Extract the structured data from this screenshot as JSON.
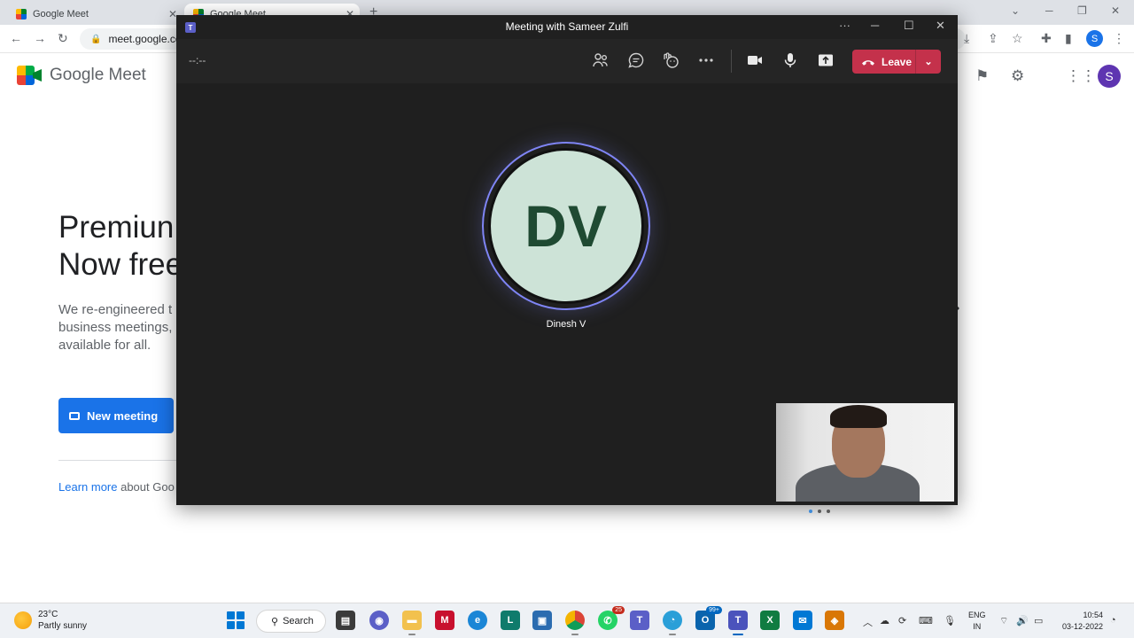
{
  "browser": {
    "tabs": [
      {
        "title": "Google Meet",
        "active": false
      },
      {
        "title": "Google Meet",
        "active": true
      }
    ],
    "new_tab_glyph": "+",
    "url": "meet.google.co",
    "profile_initial": "S"
  },
  "meet_page": {
    "logo_text": "Google Meet",
    "headline_line1": "Premiun",
    "headline_line2": "Now free",
    "sub_line1": "We re-engineered t",
    "sub_line2": "business meetings,",
    "sub_line3": "available for all.",
    "new_meeting_label": "New meeting",
    "learn_more_link": "Learn more",
    "learn_more_rest": " about Goo",
    "avatar_initial": "S"
  },
  "teams_window": {
    "title": "Meeting with Sameer Zulfi",
    "timer": "--:--",
    "leave_label": "Leave",
    "participant": {
      "initials": "DV",
      "name": "Dinesh V"
    },
    "colors": {
      "leave": "#c4314b",
      "ring": "#7f85f5",
      "avatar_bg": "#cde3d7"
    }
  },
  "taskbar": {
    "weather_temp": "23°C",
    "weather_desc": "Partly sunny",
    "search_label": "Search",
    "whatsapp_badge": "25",
    "outlook_badge": "99+",
    "lang_line1": "ENG",
    "lang_line2": "IN",
    "time": "10:54",
    "date": "03-12-2022"
  }
}
